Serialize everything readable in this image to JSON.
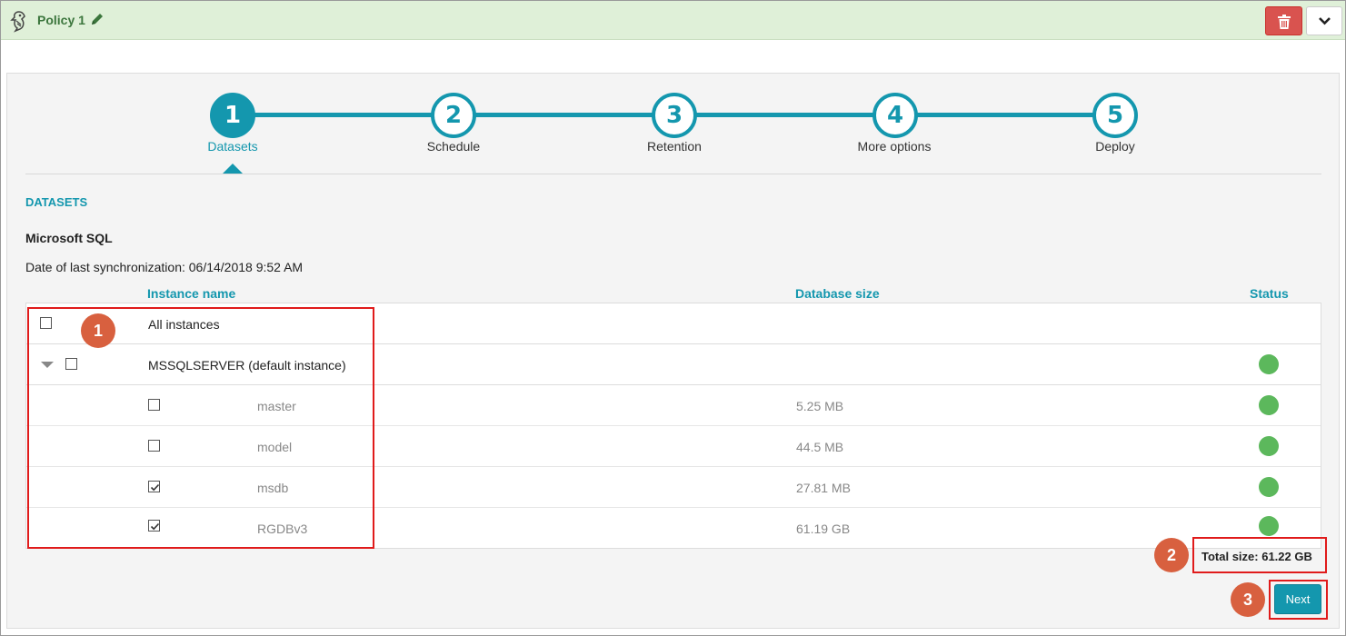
{
  "header": {
    "title": "Policy 1",
    "icons": {
      "logo": "pelican-logo-icon",
      "edit": "pencil-icon",
      "delete": "trash-icon",
      "menu": "chevron-down-icon"
    },
    "colors": {
      "header_bg": "#dff0d8",
      "title": "#3c763d",
      "danger": "#d9534f"
    }
  },
  "stepper": {
    "steps": [
      {
        "number": "1",
        "label": "Datasets",
        "active": true
      },
      {
        "number": "2",
        "label": "Schedule",
        "active": false
      },
      {
        "number": "3",
        "label": "Retention",
        "active": false
      },
      {
        "number": "4",
        "label": "More options",
        "active": false
      },
      {
        "number": "5",
        "label": "Deploy",
        "active": false
      }
    ],
    "accent": "#1497ae"
  },
  "section": {
    "title": "DATASETS",
    "db_type": "Microsoft SQL",
    "sync": "Date of last synchronization: 06/14/2018 9:52 AM"
  },
  "table": {
    "columns": {
      "name": "Instance name",
      "size": "Database size",
      "status": "Status"
    },
    "all_instances": {
      "label": "All instances",
      "checked": false
    },
    "instance": {
      "label": "MSSQLSERVER (default instance)",
      "checked": false,
      "status": "online"
    },
    "databases": [
      {
        "name": "master",
        "size": "5.25 MB",
        "checked": false,
        "status": "online"
      },
      {
        "name": "model",
        "size": "44.5 MB",
        "checked": false,
        "status": "online"
      },
      {
        "name": "msdb",
        "size": "27.81 MB",
        "checked": true,
        "status": "online"
      },
      {
        "name": "RGDBv3",
        "size": "61.19 GB",
        "checked": true,
        "status": "online"
      }
    ],
    "status_color": "#5cb85c"
  },
  "footer": {
    "total_size": "Total size: 61.22 GB",
    "next_label": "Next"
  },
  "annotations": {
    "markers": [
      "1",
      "2",
      "3"
    ],
    "marker_color": "#d8603f",
    "box_color": "#e01b1b"
  }
}
